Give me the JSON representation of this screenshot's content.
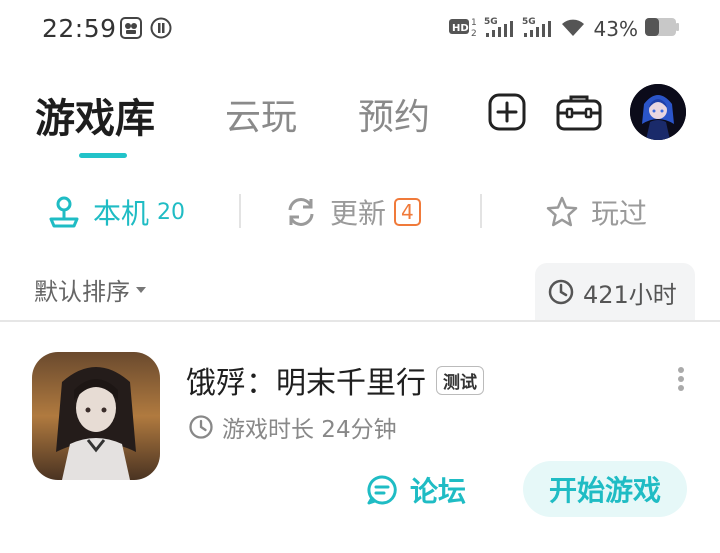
{
  "status_bar": {
    "time": "22:59",
    "battery_percent": "43%",
    "signal_labels": [
      "HD",
      "5G",
      "5G"
    ],
    "icons": [
      "shield-app-icon",
      "notification-app-icon",
      "hd-icon",
      "signal-5g-icon",
      "signal-5g-icon",
      "wifi-icon",
      "battery-icon"
    ]
  },
  "header": {
    "tabs": [
      {
        "label": "游戏库",
        "active": true
      },
      {
        "label": "云玩",
        "active": false
      },
      {
        "label": "预约",
        "active": false
      }
    ],
    "icons": [
      "add-icon",
      "toolbox-icon",
      "avatar"
    ]
  },
  "sub_tabs": [
    {
      "label": "本机",
      "count": "20",
      "icon": "joystick-icon",
      "active": true
    },
    {
      "label": "更新",
      "badge": "4",
      "icon": "refresh-icon",
      "active": false
    },
    {
      "label": "玩过",
      "icon": "star-icon",
      "active": false
    }
  ],
  "sort": {
    "label": "默认排序"
  },
  "total_playtime": "421小时",
  "games": [
    {
      "title": "饿殍：明末千里行",
      "tag": "测试",
      "duration": "游戏时长 24分钟",
      "forum_label": "论坛",
      "play_label": "开始游戏"
    }
  ],
  "colors": {
    "accent": "#1fbcc4",
    "badge": "#f07a3a"
  }
}
